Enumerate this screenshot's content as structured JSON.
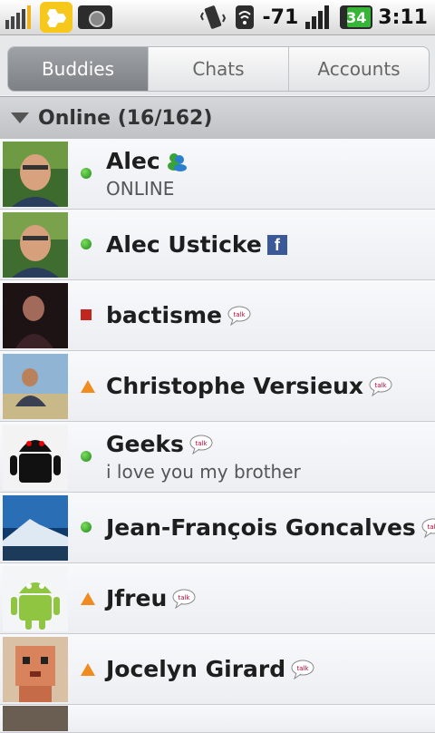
{
  "status_bar": {
    "signal_text": "-71",
    "battery_level": "34",
    "time": "3:11",
    "icons": [
      "signal-app-icon",
      "hexagon-app-icon",
      "camera-icon",
      "vibrate-icon",
      "wifi-icon",
      "cell-signal-icon",
      "battery-icon"
    ]
  },
  "tabs": [
    {
      "label": "Buddies",
      "active": true
    },
    {
      "label": "Chats",
      "active": false
    },
    {
      "label": "Accounts",
      "active": false
    }
  ],
  "group": {
    "title": "Online (16/162)"
  },
  "buddies": [
    {
      "name": "Alec",
      "status_text": "ONLINE",
      "presence": "online",
      "service": "msn"
    },
    {
      "name": "Alec Usticke",
      "status_text": "",
      "presence": "online",
      "service": "facebook"
    },
    {
      "name": "bactisme",
      "status_text": "",
      "presence": "busy",
      "service": "talk"
    },
    {
      "name": "Christophe Versieux",
      "status_text": "",
      "presence": "away",
      "service": "talk"
    },
    {
      "name": "Geeks",
      "status_text": "i love you my brother",
      "presence": "online",
      "service": "talk"
    },
    {
      "name": "Jean-François Goncalves",
      "status_text": "",
      "presence": "online",
      "service": "talk"
    },
    {
      "name": "Jfreu",
      "status_text": "",
      "presence": "away",
      "service": "talk"
    },
    {
      "name": "Jocelyn Girard",
      "status_text": "",
      "presence": "away",
      "service": "talk"
    }
  ],
  "colors": {
    "online": "#2aa32a",
    "busy": "#c1271f",
    "away": "#ef8b1f",
    "active_tab": "#8a8d92"
  }
}
